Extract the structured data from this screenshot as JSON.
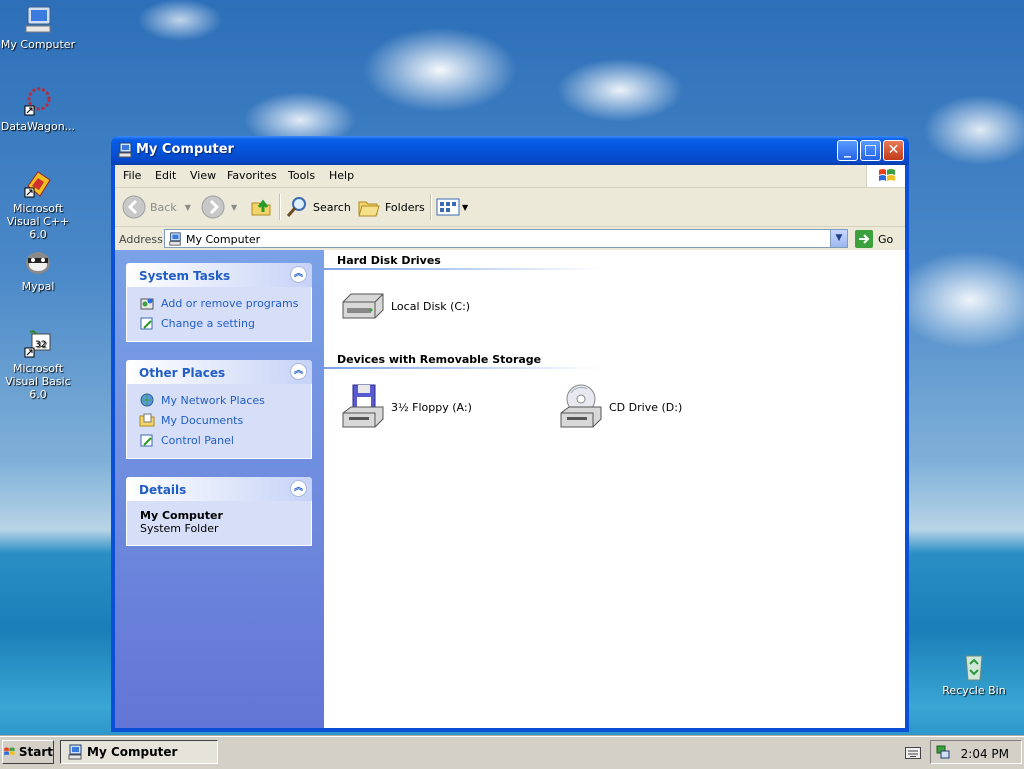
{
  "desktop": {
    "icons": [
      {
        "label": "My Computer",
        "icon": "my-computer-icon"
      },
      {
        "label": "DataWagon...",
        "icon": "datawagon-icon"
      },
      {
        "label": "Microsoft Visual C++ 6.0",
        "icon": "visual-cpp-icon"
      },
      {
        "label": "Mypal",
        "icon": "mypal-icon"
      },
      {
        "label": "Microsoft Visual Basic 6.0",
        "icon": "visual-basic-icon"
      },
      {
        "label": "Recycle Bin",
        "icon": "recycle-bin-icon"
      }
    ]
  },
  "window": {
    "title": "My Computer",
    "menu": [
      "File",
      "Edit",
      "View",
      "Favorites",
      "Tools",
      "Help"
    ],
    "toolbar": {
      "back": "Back",
      "search": "Search",
      "folders": "Folders"
    },
    "address": {
      "label": "Address",
      "value": "My Computer",
      "go": "Go"
    },
    "taskpane": {
      "system_tasks": {
        "title": "System Tasks",
        "items": [
          "Add or remove programs",
          "Change a setting"
        ]
      },
      "other_places": {
        "title": "Other Places",
        "items": [
          "My Network Places",
          "My Documents",
          "Control Panel"
        ]
      },
      "details": {
        "title": "Details",
        "name": "My Computer",
        "type": "System Folder"
      }
    },
    "groups": [
      {
        "title": "Hard Disk Drives",
        "items": [
          "Local Disk (C:)"
        ]
      },
      {
        "title": "Devices with Removable Storage",
        "items": [
          "3½ Floppy (A:)",
          "CD Drive (D:)"
        ]
      }
    ]
  },
  "taskbar": {
    "start": "Start",
    "task": "My Computer",
    "clock": "2:04 PM"
  },
  "colors": {
    "titlebar": "#0553d9",
    "taskpane_link": "#215dc6",
    "taskpane_bg": "#6375d6"
  }
}
